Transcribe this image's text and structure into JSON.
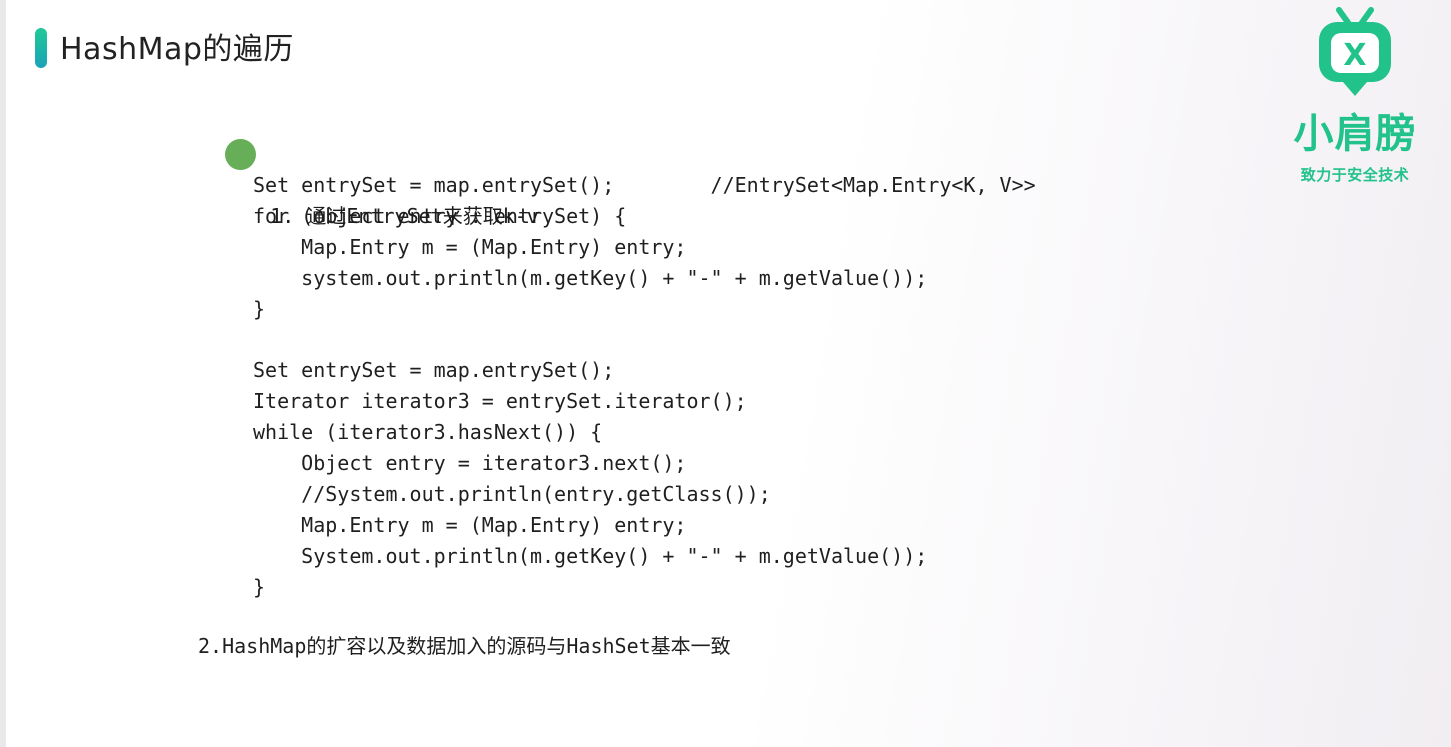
{
  "title": "HashMap的遍历",
  "logo": {
    "icon": "tv-x-icon",
    "name": "小肩膀",
    "slogan": "致力于安全技术",
    "color": "#22c28b"
  },
  "accent_color": "#20c997",
  "item1": {
    "number": "1.",
    "text": "通过EntrySet来获取k-v",
    "code": [
      "Set entrySet = map.entrySet();        //EntrySet<Map.Entry<K, V>>",
      "for (object entry : entrySet) {",
      "    Map.Entry m = (Map.Entry) entry;",
      "    system.out.println(m.getKey() + \"-\" + m.getValue());",
      "}",
      "",
      "Set entrySet = map.entrySet();",
      "Iterator iterator3 = entrySet.iterator();",
      "while (iterator3.hasNext()) {",
      "    Object entry = iterator3.next();",
      "    //System.out.println(entry.getClass());",
      "    Map.Entry m = (Map.Entry) entry;",
      "    System.out.println(m.getKey() + \"-\" + m.getValue());",
      "}"
    ]
  },
  "item2": {
    "text": "2.HashMap的扩容以及数据加入的源码与HashSet基本一致"
  }
}
